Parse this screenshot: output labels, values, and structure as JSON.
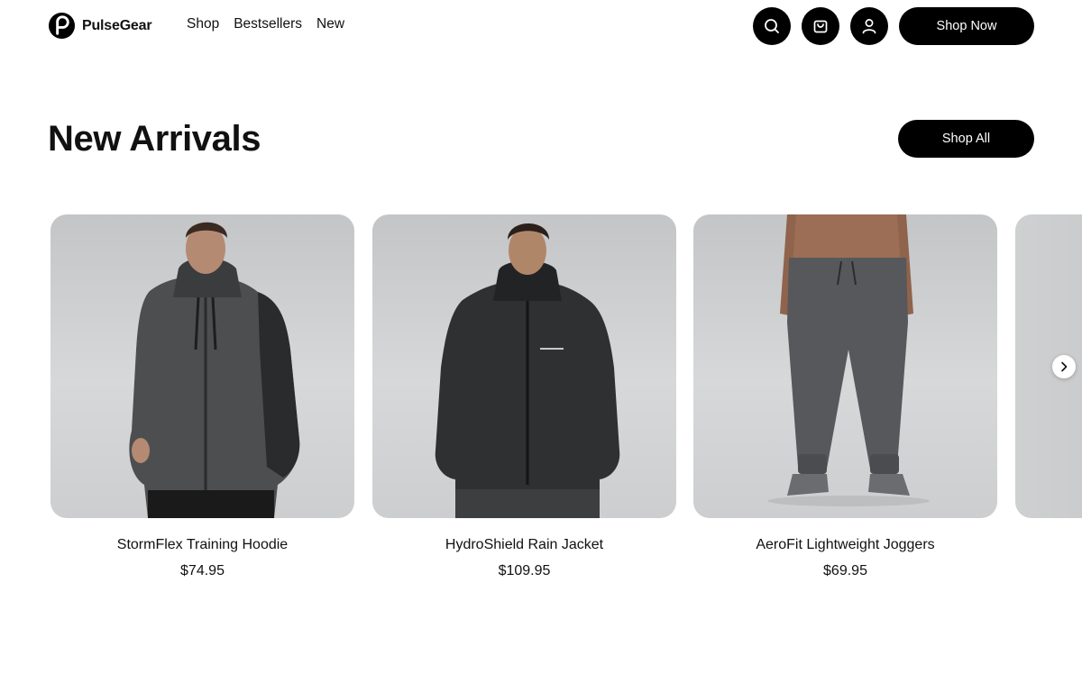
{
  "brand": {
    "name": "PulseGear",
    "logo_icon": "p-logo-icon"
  },
  "nav": {
    "items": [
      {
        "label": "Shop"
      },
      {
        "label": "Bestsellers"
      },
      {
        "label": "New"
      }
    ]
  },
  "header": {
    "search_icon": "search-icon",
    "cart_icon": "shopping-bag-icon",
    "account_icon": "user-icon",
    "cta_label": "Shop Now"
  },
  "section": {
    "title": "New Arrivals",
    "shop_all_label": "Shop All"
  },
  "products": [
    {
      "name": "StormFlex Training Hoodie",
      "price": "$74.95",
      "image": "gray-zip-hoodie-photo"
    },
    {
      "name": "HydroShield Rain Jacket",
      "price": "$109.95",
      "image": "black-rain-jacket-photo"
    },
    {
      "name": "AeroFit Lightweight Joggers",
      "price": "$69.95",
      "image": "gray-joggers-photo"
    }
  ],
  "carousel": {
    "next_icon": "chevron-right-icon"
  },
  "colors": {
    "primary": "#000000",
    "background": "#ffffff",
    "text": "#111111",
    "photo_bg": "#cfd0d1"
  }
}
